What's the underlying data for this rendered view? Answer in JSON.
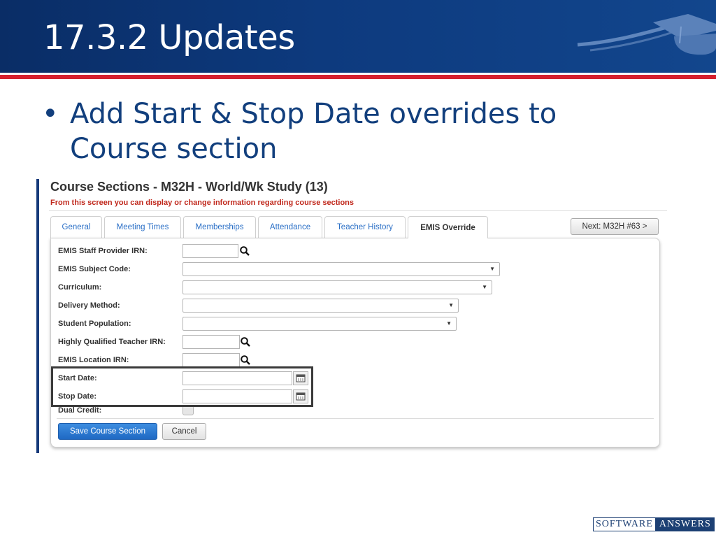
{
  "slide": {
    "title": "17.3.2 Updates",
    "bullet": {
      "marker": "•",
      "text": "Add Start & Stop Date overrides to Course section"
    }
  },
  "screen": {
    "title": "Course Sections - M32H - World/Wk Study (13)",
    "subtitle": "From this screen you can display or change information regarding course sections",
    "tabs": [
      {
        "label": "General",
        "active": false
      },
      {
        "label": "Meeting Times",
        "active": false
      },
      {
        "label": "Memberships",
        "active": false
      },
      {
        "label": "Attendance",
        "active": false
      },
      {
        "label": "Teacher History",
        "active": false
      },
      {
        "label": "EMIS Override",
        "active": true
      }
    ],
    "next_button": "Next: M32H #63 >",
    "fields": {
      "staff_provider_irn": {
        "label": "EMIS Staff Provider IRN:",
        "value": ""
      },
      "subject_code": {
        "label": "EMIS Subject Code:",
        "value": ""
      },
      "curriculum": {
        "label": "Curriculum:",
        "value": ""
      },
      "delivery_method": {
        "label": "Delivery Method:",
        "value": ""
      },
      "student_population": {
        "label": "Student Population:",
        "value": ""
      },
      "hq_teacher_irn": {
        "label": "Highly Qualified Teacher IRN:",
        "value": ""
      },
      "location_irn": {
        "label": "EMIS Location IRN:",
        "value": ""
      },
      "start_date": {
        "label": "Start Date:",
        "value": ""
      },
      "stop_date": {
        "label": "Stop Date:",
        "value": ""
      },
      "dual_credit": {
        "label": "Dual Credit:",
        "checked": false
      }
    },
    "save_button": "Save Course Section",
    "cancel_button": "Cancel"
  },
  "footer": {
    "logo_left": "SOFTWARE",
    "logo_right": "ANSWERS"
  },
  "colors": {
    "header_blue": "#0d3a7e",
    "accent_red": "#d5202e",
    "text_blue": "#123f7d",
    "link_blue": "#2a6fc6",
    "subtitle_red": "#c0281c",
    "primary_button": "#2a78d4"
  },
  "icons": {
    "lookup": "magnifier-icon",
    "date_picker": "calendar-icon",
    "dropdown": "caret-down-icon",
    "header_logo": "graduation-cap-icon"
  }
}
